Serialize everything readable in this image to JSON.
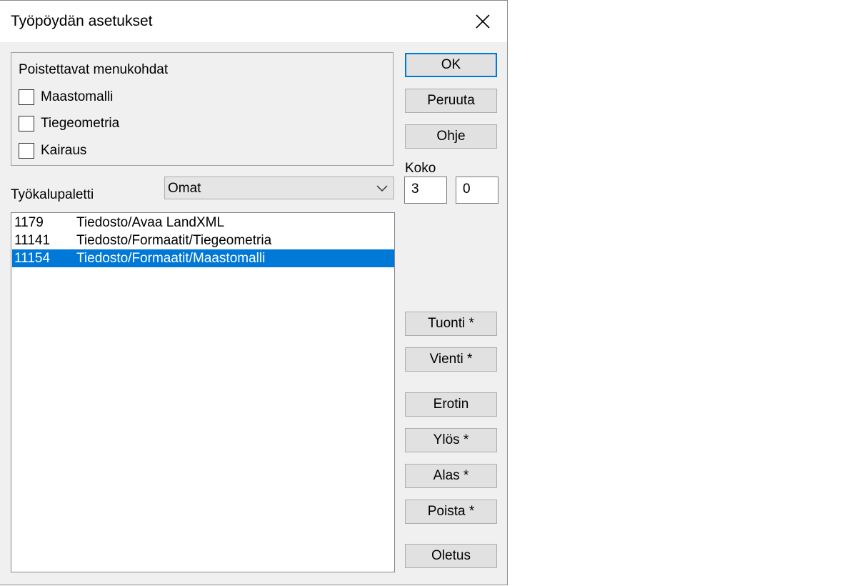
{
  "window": {
    "title": "Työpöydän asetukset"
  },
  "group": {
    "label": "Poistettavat menukohdat",
    "checkboxes": [
      {
        "label": "Maastomalli",
        "checked": false
      },
      {
        "label": "Tiegeometria",
        "checked": false
      },
      {
        "label": "Kairaus",
        "checked": false
      }
    ]
  },
  "buttons": {
    "ok": "OK",
    "cancel": "Peruuta",
    "help": "Ohje",
    "import": "Tuonti *",
    "export": "Vienti *",
    "separator": "Erotin",
    "up": "Ylös *",
    "down": "Alas *",
    "delete": "Poista *",
    "default": "Oletus"
  },
  "size": {
    "label": "Koko",
    "value1": "3",
    "value2": "0"
  },
  "palette": {
    "label": "Työkalupaletti",
    "selected": "Omat"
  },
  "list": {
    "items": [
      {
        "id": "1179",
        "path": "Tiedosto/Avaa LandXML",
        "selected": false
      },
      {
        "id": "11141",
        "path": "Tiedosto/Formaatit/Tiegeometria",
        "selected": false
      },
      {
        "id": "11154",
        "path": "Tiedosto/Formaatit/Maastomalli",
        "selected": true
      }
    ]
  },
  "colors": {
    "accent": "#0078d7",
    "dialog_bg": "#f0f0f0",
    "button_bg": "#e1e1e1"
  },
  "icons": {
    "close": "close-icon",
    "dropdown": "chevron-down-icon"
  }
}
